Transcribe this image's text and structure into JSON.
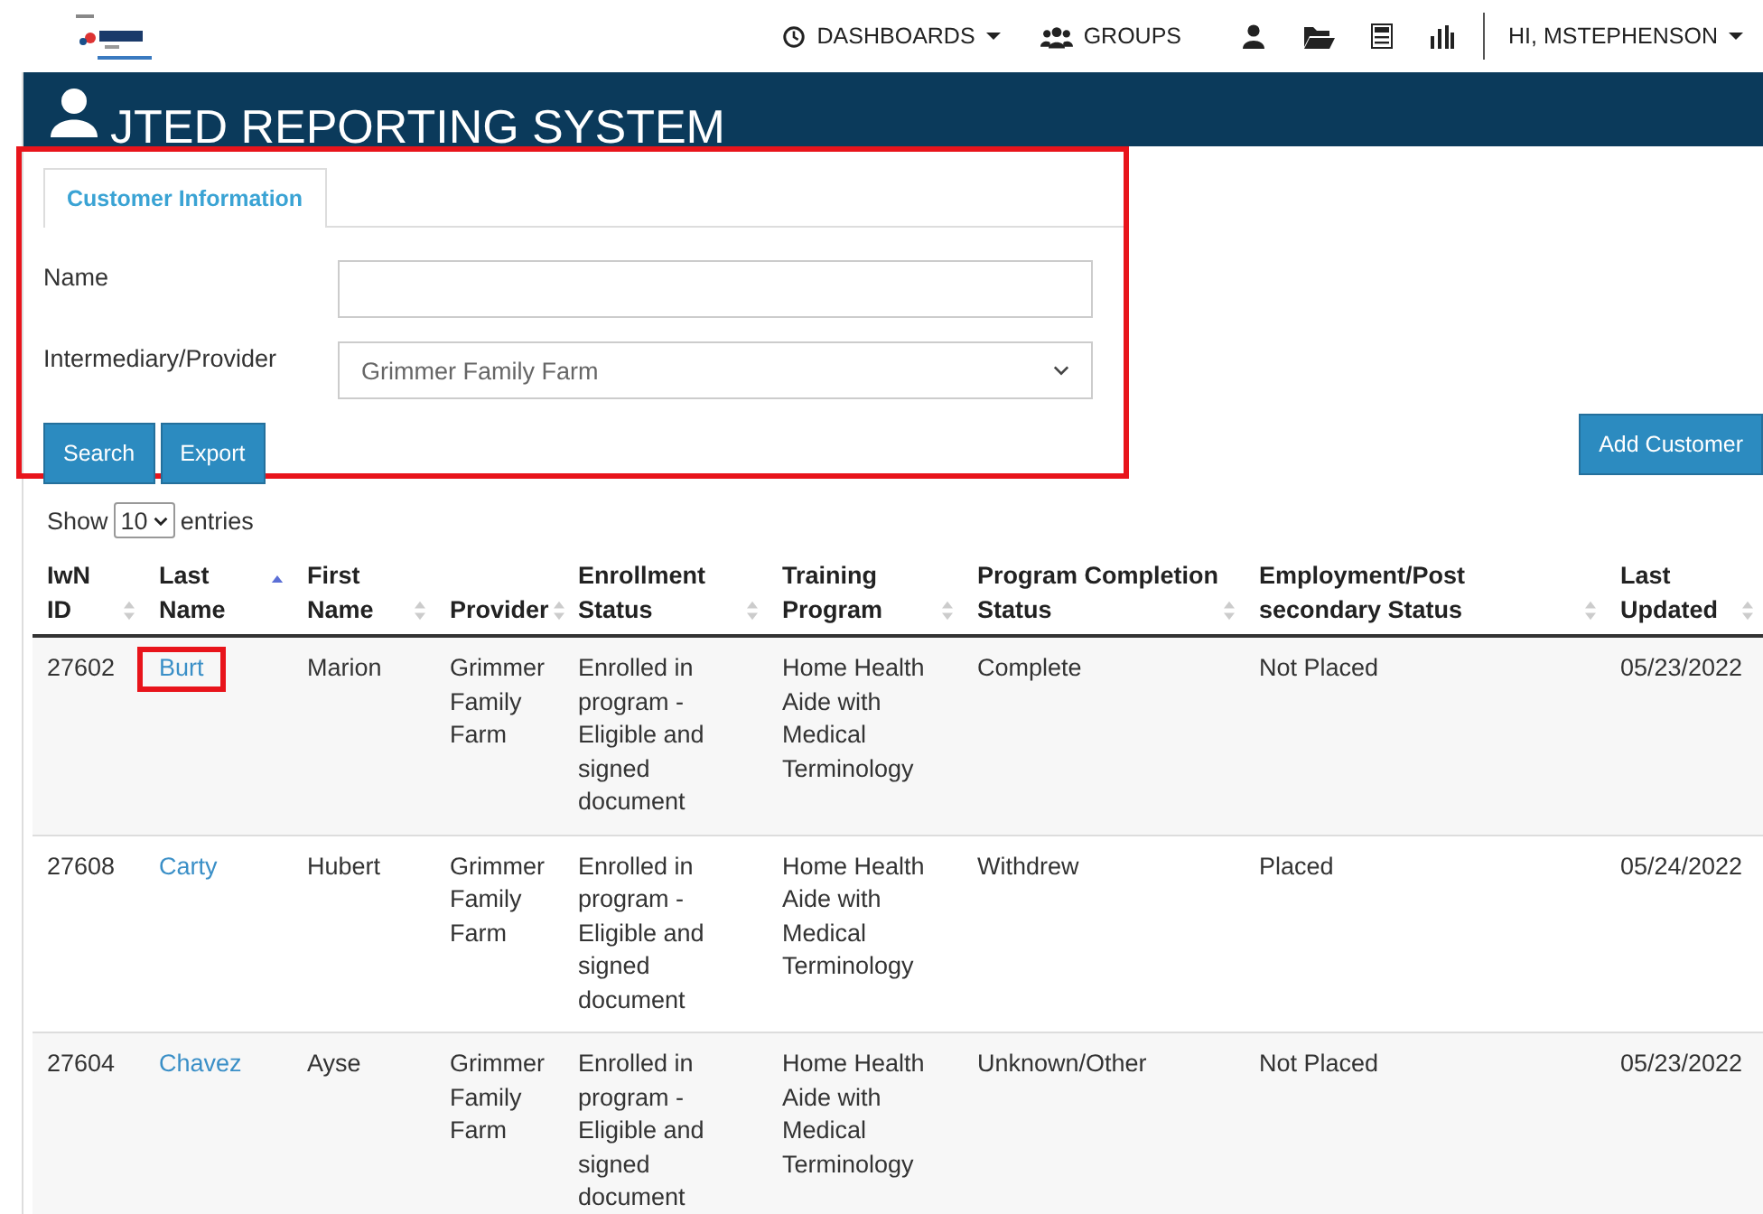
{
  "nav": {
    "items": [
      {
        "kind": "dashboards",
        "label": "DASHBOARDS",
        "dropdown": true
      },
      {
        "kind": "groups",
        "label": "GROUPS",
        "dropdown": false
      },
      {
        "kind": "user"
      },
      {
        "kind": "folder"
      },
      {
        "kind": "calculator"
      },
      {
        "kind": "chart"
      }
    ],
    "user_menu": {
      "label": "HI, MSTEPHENSON",
      "dropdown": true
    }
  },
  "banner": {
    "title": "JTED REPORTING SYSTEM"
  },
  "form": {
    "highlighted": true,
    "tabs": [
      {
        "label": "Customer Information",
        "selected": true
      }
    ],
    "fields": [
      {
        "kind": "text",
        "label": "Name"
      },
      {
        "kind": "select",
        "label": "Intermediary/Provider",
        "value": "Grimmer Family Farm"
      }
    ],
    "buttons": [
      "Search",
      "Export"
    ]
  },
  "add_button": "Add Customer",
  "length": {
    "prefix": "Show",
    "value": "10",
    "suffix": "entries"
  },
  "table": {
    "columns": [
      {
        "label": "IwN ID",
        "sorted": false
      },
      {
        "label": "Last Name",
        "sorted": true
      },
      {
        "label": "First Name",
        "sorted": false
      },
      {
        "label": "Provider",
        "sorted": false
      },
      {
        "label": "Enrollment Status",
        "sorted": false
      },
      {
        "label": "Training Program",
        "sorted": false
      },
      {
        "label": "Program Completion Status",
        "sorted": false
      },
      {
        "label": "Employment/Post secondary Status",
        "sorted": false
      },
      {
        "label": "Last Updated",
        "sorted": false
      }
    ],
    "rows": [
      {
        "id": "27602",
        "last": "Burt",
        "highlighted": true,
        "first": "Marion",
        "provider": "Grimmer Family Farm",
        "enrollment": "Enrolled in program - Eligible and signed document",
        "training": "Home Health Aide with Medical Terminology",
        "completion": "Complete",
        "employment": "Not Placed",
        "updated": "05/23/2022"
      },
      {
        "id": "27608",
        "last": "Carty",
        "highlighted": false,
        "first": "Hubert",
        "provider": "Grimmer Family Farm",
        "enrollment": "Enrolled in program - Eligible and signed document",
        "training": "Home Health Aide with Medical Terminology",
        "completion": "Withdrew",
        "employment": "Placed",
        "updated": "05/24/2022"
      },
      {
        "id": "27604",
        "last": "Chavez",
        "highlighted": false,
        "first": "Ayse",
        "provider": "Grimmer Family Farm",
        "enrollment": "Enrolled in program - Eligible and signed document",
        "training": "Home Health Aide with Medical Terminology",
        "completion": "Unknown/Other",
        "employment": "Not Placed",
        "updated": "05/23/2022"
      }
    ]
  }
}
